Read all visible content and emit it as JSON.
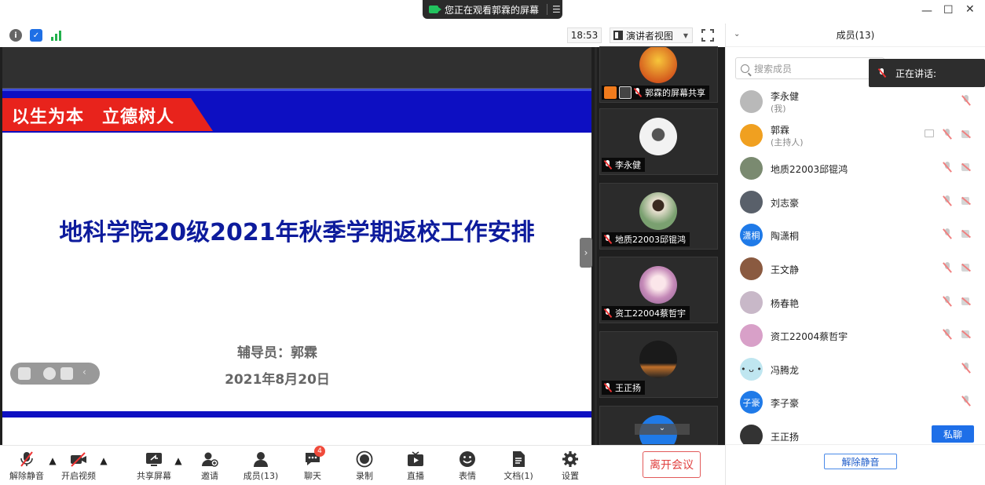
{
  "share_banner": {
    "text": "您正在观看郭霖的屏幕"
  },
  "toprow": {
    "time": "18:53",
    "view_mode": "演讲者视图"
  },
  "slide": {
    "banner": "以生为本　立德树人",
    "title": "地科学院20级2021年秋季学期返校工作安排",
    "counselor": "辅导员：郭霖",
    "date": "2021年8月20日"
  },
  "tiles": [
    {
      "name": "郭霖的屏幕共享"
    },
    {
      "name": "李永健"
    },
    {
      "name": "地质22003邱锟鸿"
    },
    {
      "name": "资工22004蔡哲宇"
    },
    {
      "name": "王正扬"
    }
  ],
  "toolbar": {
    "unmute": "解除静音",
    "video": "开启视频",
    "share": "共享屏幕",
    "invite": "邀请",
    "members": "成员(13)",
    "chat": "聊天",
    "chat_badge": "4",
    "record": "录制",
    "live": "直播",
    "emoji": "表情",
    "docs": "文档(1)",
    "settings": "设置",
    "leave": "离开会议"
  },
  "panel": {
    "title": "成员(13)",
    "search_placeholder": "搜索成员",
    "speaking": "正在讲话:",
    "members": [
      {
        "name": "李永健",
        "role": "(我)",
        "avatar_text": "",
        "color": "#b9b9b9"
      },
      {
        "name": "郭霖",
        "role": "(主持人)",
        "avatar_text": "",
        "color": "#f0a020"
      },
      {
        "name": "地质22003邱锟鸿",
        "role": "",
        "avatar_text": "",
        "color": "#7a8a70"
      },
      {
        "name": "刘志豪",
        "role": "",
        "avatar_text": "",
        "color": "#59606a"
      },
      {
        "name": "陶潇桐",
        "role": "",
        "avatar_text": "潇桐",
        "color": "#1f7ae8"
      },
      {
        "name": "王文静",
        "role": "",
        "avatar_text": "",
        "color": "#8a5a40"
      },
      {
        "name": "杨春艳",
        "role": "",
        "avatar_text": "",
        "color": "#c8b8c8"
      },
      {
        "name": "资工22004蔡哲宇",
        "role": "",
        "avatar_text": "",
        "color": "#d8a0c8"
      },
      {
        "name": "冯腾龙",
        "role": "",
        "avatar_text": "• ᴗ •",
        "color": "#bfe6f0"
      },
      {
        "name": "李子豪",
        "role": "",
        "avatar_text": "子豪",
        "color": "#1f7ae8"
      },
      {
        "name": "王正扬",
        "role": "",
        "avatar_text": "",
        "color": "#333"
      }
    ],
    "private_chat": "私聊",
    "unmute_all": "解除静音"
  }
}
